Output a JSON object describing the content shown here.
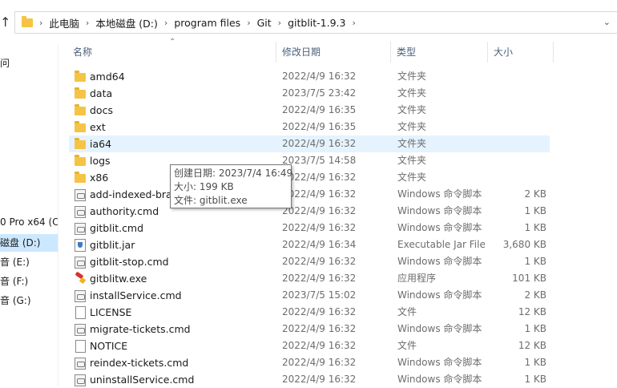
{
  "address_bar": {
    "crumbs": [
      "此电脑",
      "本地磁盘 (D:)",
      "program files",
      "Git",
      "gitblit-1.9.3"
    ]
  },
  "nav": {
    "items": [
      {
        "label": "问",
        "selected": false
      },
      {
        "label": "0 Pro x64 (C",
        "selected": false
      },
      {
        "label": "磁盘 (D:)",
        "selected": true
      },
      {
        "label": "音 (E:)",
        "selected": false
      },
      {
        "label": "音 (F:)",
        "selected": false
      },
      {
        "label": "音 (G:)",
        "selected": false
      }
    ]
  },
  "columns": {
    "name": "名称",
    "date": "修改日期",
    "type": "类型",
    "size": "大小"
  },
  "files": [
    {
      "name": "amd64",
      "date": "2022/4/9 16:32",
      "type": "文件夹",
      "size": "",
      "icon": "folder-icon"
    },
    {
      "name": "data",
      "date": "2023/7/5 23:42",
      "type": "文件夹",
      "size": "",
      "icon": "folder-icon"
    },
    {
      "name": "docs",
      "date": "2022/4/9 16:35",
      "type": "文件夹",
      "size": "",
      "icon": "folder-icon"
    },
    {
      "name": "ext",
      "date": "2022/4/9 16:35",
      "type": "文件夹",
      "size": "",
      "icon": "folder-icon"
    },
    {
      "name": "ia64",
      "date": "2022/4/9 16:32",
      "type": "文件夹",
      "size": "",
      "icon": "folder-icon"
    },
    {
      "name": "logs",
      "date": "2023/7/5 14:58",
      "type": "文件夹",
      "size": "",
      "icon": "folder-icon"
    },
    {
      "name": "x86",
      "date": "2022/4/9 16:32",
      "type": "文件夹",
      "size": "",
      "icon": "folder-icon"
    },
    {
      "name": "add-indexed-bra",
      "date": "2022/4/9 16:32",
      "type": "Windows 命令脚本",
      "size": "2 KB",
      "icon": "cmd-script-icon"
    },
    {
      "name": "authority.cmd",
      "date": "2022/4/9 16:32",
      "type": "Windows 命令脚本",
      "size": "1 KB",
      "icon": "cmd-script-icon"
    },
    {
      "name": "gitblit.cmd",
      "date": "2022/4/9 16:32",
      "type": "Windows 命令脚本",
      "size": "1 KB",
      "icon": "cmd-script-icon"
    },
    {
      "name": "gitblit.jar",
      "date": "2022/4/9 16:34",
      "type": "Executable Jar File",
      "size": "3,680 KB",
      "icon": "jar-file-icon"
    },
    {
      "name": "gitblit-stop.cmd",
      "date": "2022/4/9 16:32",
      "type": "Windows 命令脚本",
      "size": "1 KB",
      "icon": "cmd-script-icon"
    },
    {
      "name": "gitblitw.exe",
      "date": "2022/4/9 16:32",
      "type": "应用程序",
      "size": "101 KB",
      "icon": "exe-app-icon"
    },
    {
      "name": "installService.cmd",
      "date": "2023/7/5 15:02",
      "type": "Windows 命令脚本",
      "size": "2 KB",
      "icon": "cmd-script-icon"
    },
    {
      "name": "LICENSE",
      "date": "2022/4/9 16:32",
      "type": "文件",
      "size": "12 KB",
      "icon": "file-icon"
    },
    {
      "name": "migrate-tickets.cmd",
      "date": "2022/4/9 16:32",
      "type": "Windows 命令脚本",
      "size": "1 KB",
      "icon": "cmd-script-icon"
    },
    {
      "name": "NOTICE",
      "date": "2022/4/9 16:32",
      "type": "文件",
      "size": "12 KB",
      "icon": "file-icon"
    },
    {
      "name": "reindex-tickets.cmd",
      "date": "2022/4/9 16:32",
      "type": "Windows 命令脚本",
      "size": "1 KB",
      "icon": "cmd-script-icon"
    },
    {
      "name": "uninstallService.cmd",
      "date": "2022/4/9 16:32",
      "type": "Windows 命令脚本",
      "size": "1 KB",
      "icon": "cmd-script-icon"
    }
  ],
  "hover_index": 4,
  "tooltip": {
    "created": "创建日期: 2023/7/4 16:49",
    "size": "大小: 199 KB",
    "files": "文件: gitblit.exe"
  },
  "colors": {
    "hover_row": "#e5f3ff",
    "selected_nav": "#cce8ff",
    "folder": "#f6c445",
    "header_text": "#4c607a"
  }
}
